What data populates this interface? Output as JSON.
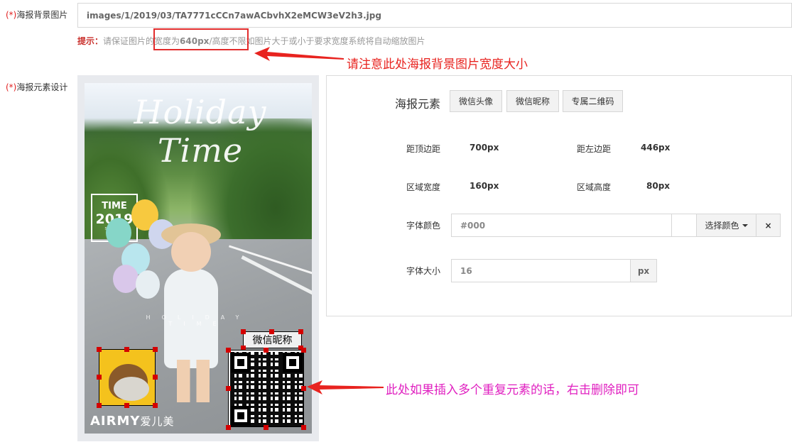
{
  "form": {
    "bg_label_req": "(*)",
    "bg_label": "海报背景图片",
    "bg_value": "images/1/2019/03/TA7771cCCn7awACbvhX2eMCW3eV2h3.jpg",
    "tip_key": "提示：",
    "tip_pre": "请保证图片的",
    "tip_width": "宽度为",
    "tip_width_value": "640px",
    "tip_height": "/高度不限",
    "tip_post": "如图片大于或小于要求宽度系统将自动缩放图片",
    "design_label_req": "(*)",
    "design_label": "海报元素设计"
  },
  "annotations": {
    "width_note": "请注意此处海报背景图片宽度大小",
    "delete_note": "此处如果插入多个重复元素的话，右击删除即可",
    "red": "#e8231f",
    "pink": "#e020c0"
  },
  "poster": {
    "title": "Holiday Time",
    "badge_line1": "TIME",
    "badge_line2": "2019",
    "badge_line3": "SHOOTING",
    "sub": "HOLIDAY TIME",
    "brand": "AIRMY",
    "brand_cn": "爱儿美",
    "nickname": "微信昵称",
    "handle_color": "#d40000"
  },
  "panel": {
    "title": "海报元素",
    "buttons": [
      "微信头像",
      "微信昵称",
      "专属二维码"
    ],
    "top_label": "距顶边距",
    "top_value": "700px",
    "left_label": "距左边距",
    "left_value": "446px",
    "width_label": "区域宽度",
    "width_value": "160px",
    "height_label": "区域高度",
    "height_value": "80px",
    "color_label": "字体颜色",
    "color_value": "#000",
    "color_button": "选择颜色",
    "clear_icon": "×",
    "size_label": "字体大小",
    "size_value": "16",
    "size_unit": "px"
  }
}
